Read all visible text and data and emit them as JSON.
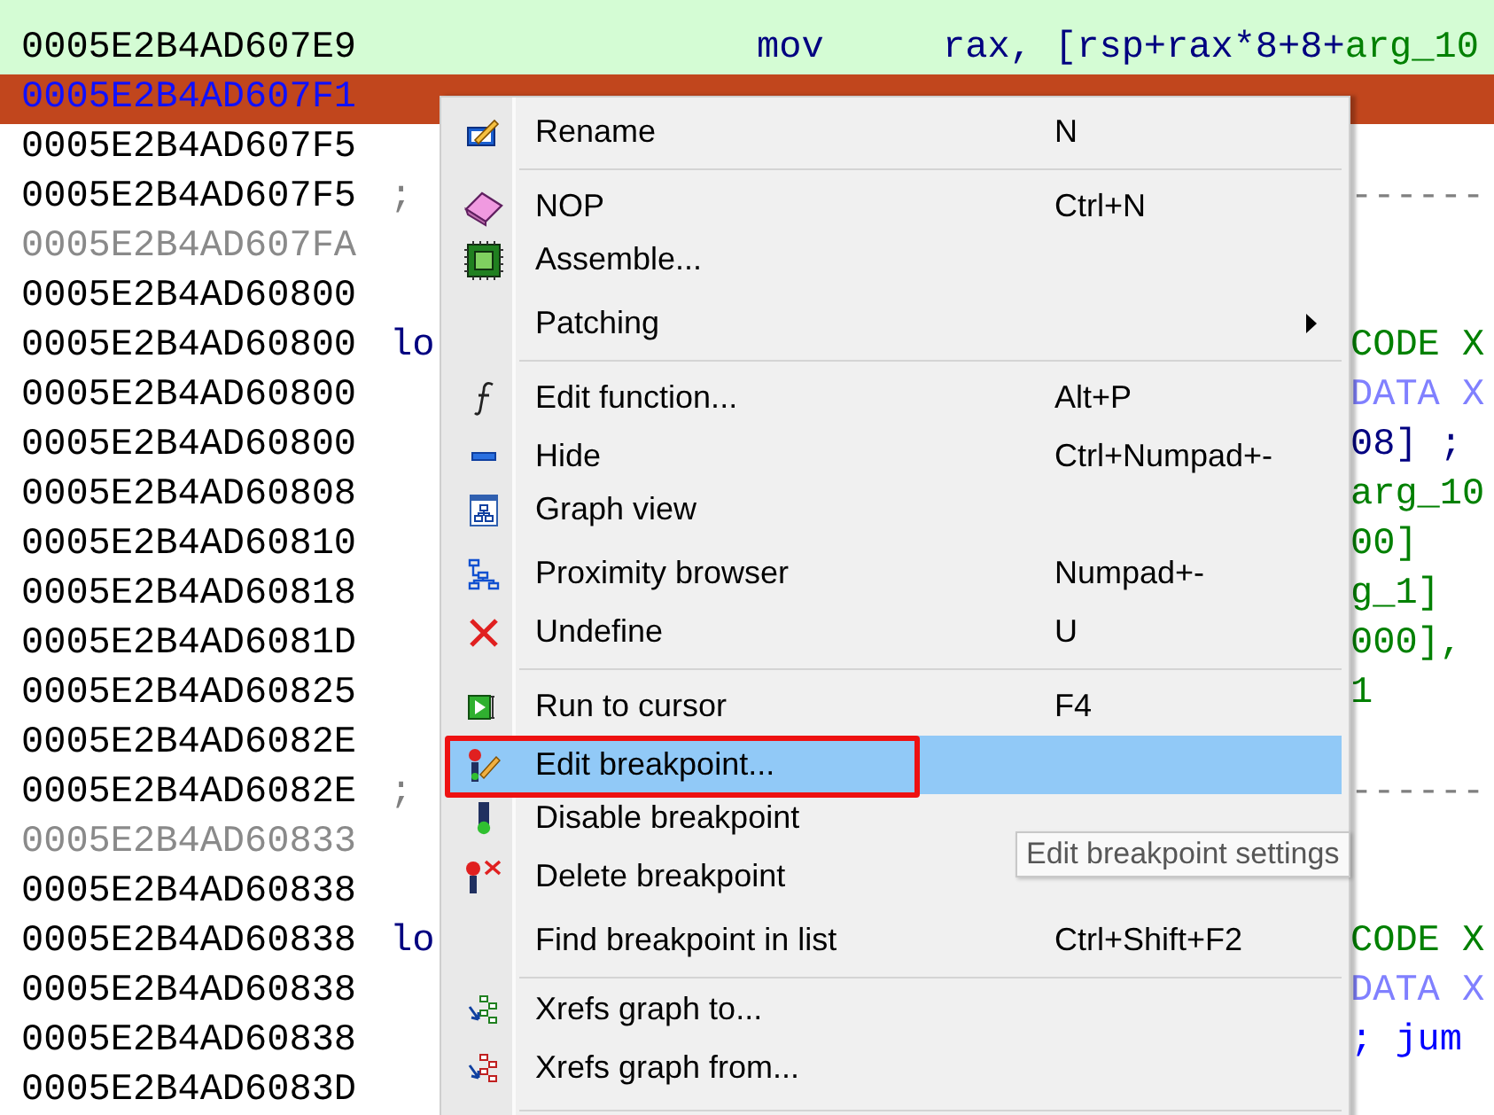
{
  "code": {
    "lines": [
      {
        "address": "0005E2B4AD607E9",
        "trace": true,
        "selected": false,
        "muted": false,
        "mnemonic": "mov",
        "operands": [
          {
            "text": "rax, [rsp+rax*8+8+",
            "kind": "plain"
          },
          {
            "text": "arg_10",
            "kind": "var"
          }
        ]
      },
      {
        "address": "0005E2B4AD607F1",
        "trace": false,
        "selected": true,
        "muted": false
      },
      {
        "address": "0005E2B4AD607F5",
        "trace": false,
        "selected": false,
        "muted": false
      },
      {
        "address": "0005E2B4AD607F5",
        "trace": false,
        "selected": false,
        "muted": false,
        "label": ";",
        "tail": {
          "text": "------",
          "kind": "separator"
        }
      },
      {
        "address": "0005E2B4AD607FA",
        "trace": false,
        "selected": false,
        "muted": true
      },
      {
        "address": "0005E2B4AD60800",
        "trace": false,
        "selected": false,
        "muted": false
      },
      {
        "address": "0005E2B4AD60800",
        "trace": false,
        "selected": false,
        "muted": false,
        "label": "lo",
        "tail": {
          "text": "CODE X",
          "kind": "code-xref"
        }
      },
      {
        "address": "0005E2B4AD60800",
        "trace": false,
        "selected": false,
        "muted": false,
        "tail": {
          "text": "DATA X",
          "kind": "data-xref"
        }
      },
      {
        "address": "0005E2B4AD60800",
        "trace": false,
        "selected": false,
        "muted": false,
        "tail": {
          "text": "08] ;",
          "kind": "operand"
        }
      },
      {
        "address": "0005E2B4AD60808",
        "trace": false,
        "selected": false,
        "muted": false,
        "tail": {
          "text": "arg_10",
          "kind": "var"
        }
      },
      {
        "address": "0005E2B4AD60810",
        "trace": false,
        "selected": false,
        "muted": false,
        "tail": {
          "text": "00]",
          "kind": "var"
        }
      },
      {
        "address": "0005E2B4AD60818",
        "trace": false,
        "selected": false,
        "muted": false,
        "tail": {
          "text": "g_1]",
          "kind": "var"
        }
      },
      {
        "address": "0005E2B4AD6081D",
        "trace": false,
        "selected": false,
        "muted": false,
        "tail": {
          "text": "000],",
          "kind": "var"
        }
      },
      {
        "address": "0005E2B4AD60825",
        "trace": false,
        "selected": false,
        "muted": false,
        "tail": {
          "text": "1",
          "kind": "var"
        }
      },
      {
        "address": "0005E2B4AD6082E",
        "trace": false,
        "selected": false,
        "muted": false
      },
      {
        "address": "0005E2B4AD6082E",
        "trace": false,
        "selected": false,
        "muted": false,
        "label": ";",
        "tail": {
          "text": "------",
          "kind": "separator"
        }
      },
      {
        "address": "0005E2B4AD60833",
        "trace": false,
        "selected": false,
        "muted": true
      },
      {
        "address": "0005E2B4AD60838",
        "trace": false,
        "selected": false,
        "muted": false
      },
      {
        "address": "0005E2B4AD60838",
        "trace": false,
        "selected": false,
        "muted": false,
        "label": "lo",
        "tail": {
          "text": "CODE X",
          "kind": "code-xref"
        }
      },
      {
        "address": "0005E2B4AD60838",
        "trace": false,
        "selected": false,
        "muted": false,
        "tail": {
          "text": "DATA X",
          "kind": "data-xref"
        }
      },
      {
        "address": "0005E2B4AD60838",
        "trace": false,
        "selected": false,
        "muted": false,
        "tail": {
          "text": " ; jum",
          "kind": "comment"
        }
      },
      {
        "address": "0005E2B4AD6083D",
        "trace": false,
        "selected": false,
        "muted": false
      }
    ]
  },
  "context_menu": {
    "sections": [
      [
        {
          "label": "Rename",
          "shortcut": "N",
          "selected": false
        }
      ],
      [
        {
          "label": "NOP",
          "shortcut": "Ctrl+N",
          "selected": false
        },
        {
          "label": "Assemble...",
          "selected": false
        },
        {
          "label": "Patching",
          "selected": false,
          "submenu": true
        }
      ],
      [
        {
          "label": "Edit function...",
          "shortcut": "Alt+P",
          "selected": false
        },
        {
          "label": "Hide",
          "shortcut": "Ctrl+Numpad+-",
          "selected": false
        },
        {
          "label": "Graph view",
          "selected": false
        },
        {
          "label": "Proximity browser",
          "shortcut": "Numpad+-",
          "selected": false
        },
        {
          "label": "Undefine",
          "shortcut": "U",
          "selected": false
        }
      ],
      [
        {
          "label": "Run to cursor",
          "shortcut": "F4",
          "selected": false
        },
        {
          "label": "Edit breakpoint...",
          "selected": true,
          "outlined": true
        },
        {
          "label": "Disable breakpoint",
          "selected": false
        },
        {
          "label": "Delete breakpoint",
          "selected": false
        },
        {
          "label": "Find breakpoint in list",
          "shortcut": "Ctrl+Shift+F2",
          "selected": false
        }
      ],
      [
        {
          "label": "Xrefs graph to...",
          "selected": false
        },
        {
          "label": "Xrefs graph from...",
          "selected": false
        }
      ]
    ]
  },
  "tooltip": {
    "text": "Edit breakpoint settings"
  }
}
